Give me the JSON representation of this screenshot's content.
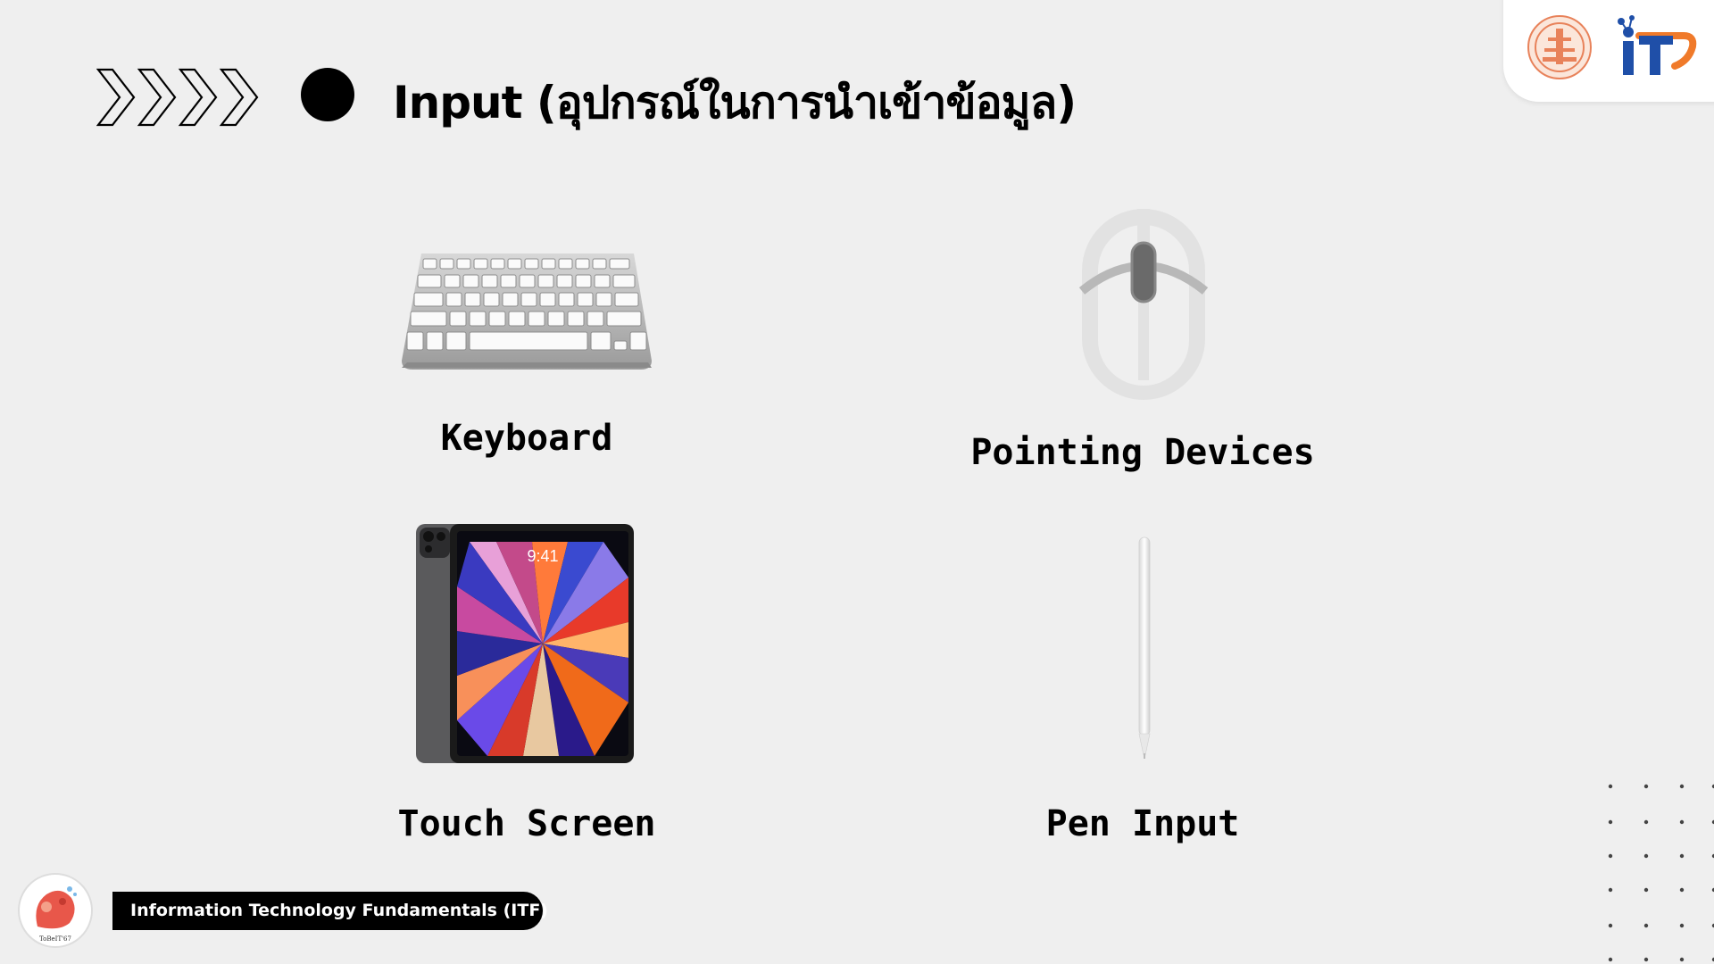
{
  "header": {
    "title": "Input (อุปกรณ์ในการนำเข้าข้อมูล)"
  },
  "items": [
    {
      "label": "Keyboard",
      "icon": "keyboard-icon"
    },
    {
      "label": "Pointing Devices",
      "icon": "mouse-icon"
    },
    {
      "label": "Touch Screen",
      "icon": "tablet-icon"
    },
    {
      "label": "Pen Input",
      "icon": "stylus-icon"
    }
  ],
  "footer": {
    "course": "Information Technology Fundamentals (ITF)",
    "mascot_caption": "ToBeIT'67"
  },
  "branding": {
    "logo_text": "iT",
    "accent_orange": "#f07a2a",
    "accent_blue": "#1f4fa8"
  }
}
